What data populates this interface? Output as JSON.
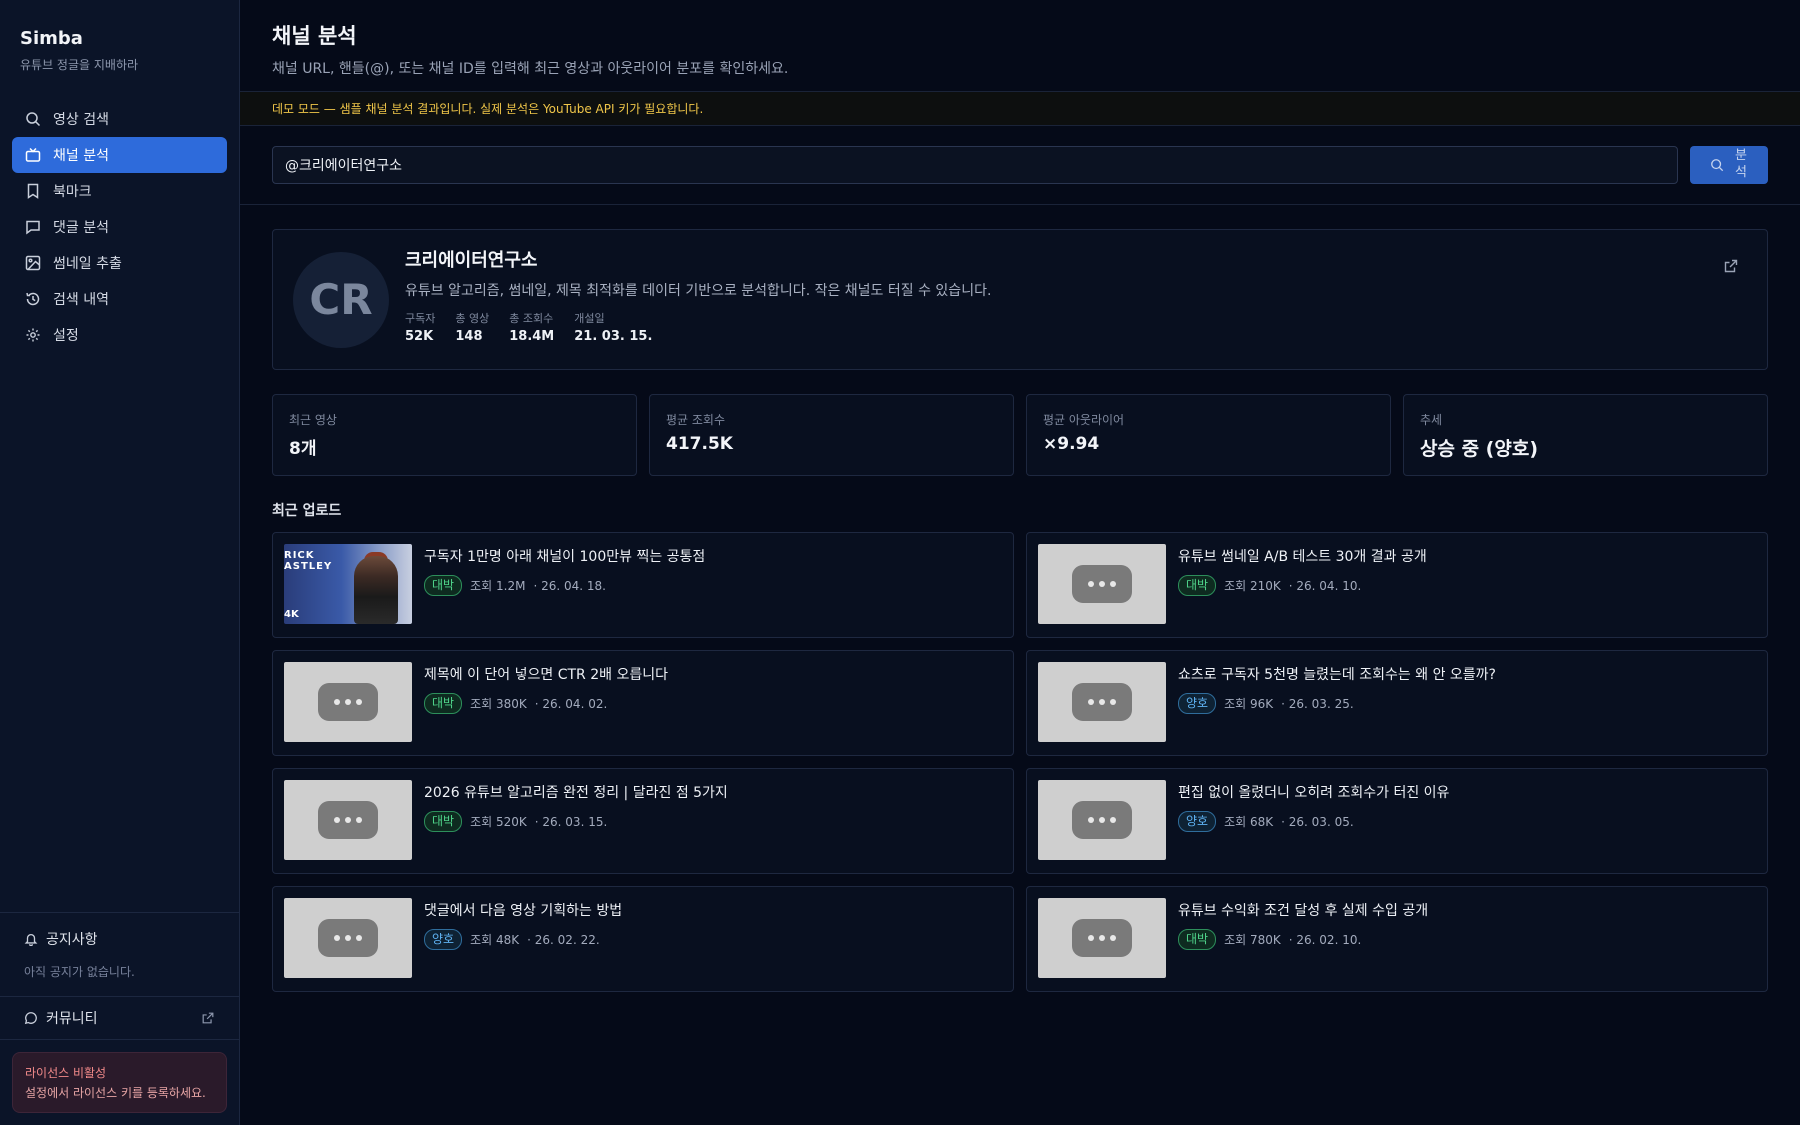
{
  "brand": {
    "name": "Simba",
    "tagline": "유튜브 정글을 지배하라"
  },
  "nav": [
    {
      "label": "영상 검색",
      "icon": "search-icon"
    },
    {
      "label": "채널 분석",
      "icon": "tv-icon",
      "active": true
    },
    {
      "label": "북마크",
      "icon": "bookmark-icon"
    },
    {
      "label": "댓글 분석",
      "icon": "comment-icon"
    },
    {
      "label": "썸네일 추출",
      "icon": "image-icon"
    },
    {
      "label": "검색 내역",
      "icon": "history-icon"
    },
    {
      "label": "설정",
      "icon": "gear-icon"
    }
  ],
  "notice": {
    "title": "공지사항",
    "empty": "아직 공지가 없습니다."
  },
  "community": {
    "label": "커뮤니티"
  },
  "license": {
    "title": "라이선스 비활성",
    "body": "설정에서 라이선스 키를 등록하세요."
  },
  "header": {
    "title": "채널 분석",
    "subtitle": "채널 URL, 핸들(@), 또는 채널 ID를 입력해 최근 영상과 아웃라이어 분포를 확인하세요."
  },
  "demo_banner": "데모 모드 — 샘플 채널 분석 결과입니다. 실제 분석은 YouTube API 키가 필요합니다.",
  "search": {
    "value": "@크리에이터연구소",
    "button_label": "분석"
  },
  "channel": {
    "avatar": "CR",
    "name": "크리에이터연구소",
    "description": "유튜브 알고리즘, 썸네일, 제목 최적화를 데이터 기반으로 분석합니다. 작은 채널도 터질 수 있습니다.",
    "stats": [
      {
        "label": "구독자",
        "value": "52K"
      },
      {
        "label": "총 영상",
        "value": "148"
      },
      {
        "label": "총 조회수",
        "value": "18.4M"
      },
      {
        "label": "개설일",
        "value": "21. 03. 15."
      }
    ]
  },
  "metrics": [
    {
      "label": "최근 영상",
      "value": "8개"
    },
    {
      "label": "평균 조회수",
      "value": "417.5K"
    },
    {
      "label": "평균 아웃라이어",
      "value": "×9.94"
    },
    {
      "label": "추세",
      "value": "상승 중 (양호)"
    }
  ],
  "recent": {
    "title": "최근 업로드",
    "videos": [
      {
        "title": "구독자 1만명 아래 채널이 100만뷰 찍는 공통점",
        "badge": "대박",
        "views": "조회 1.2M",
        "date": "· 26. 04. 18.",
        "thumb_text": "RICK\nASTLEY",
        "thumb_4k": "4K"
      },
      {
        "title": "유튜브 썸네일 A/B 테스트 30개 결과 공개",
        "badge": "대박",
        "views": "조회 210K",
        "date": "· 26. 04. 10."
      },
      {
        "title": "제목에 이 단어 넣으면 CTR 2배 오릅니다",
        "badge": "대박",
        "views": "조회 380K",
        "date": "· 26. 04. 02."
      },
      {
        "title": "쇼츠로 구독자 5천명 늘렸는데 조회수는 왜 안 오를까?",
        "badge": "양호",
        "views": "조회 96K",
        "date": "· 26. 03. 25."
      },
      {
        "title": "2026 유튜브 알고리즘 완전 정리 | 달라진 점 5가지",
        "badge": "대박",
        "views": "조회 520K",
        "date": "· 26. 03. 15."
      },
      {
        "title": "편집 없이 올렸더니 오히려 조회수가 터진 이유",
        "badge": "양호",
        "views": "조회 68K",
        "date": "· 26. 03. 05."
      },
      {
        "title": "댓글에서 다음 영상 기획하는 방법",
        "badge": "양호",
        "views": "조회 48K",
        "date": "· 26. 02. 22."
      },
      {
        "title": "유튜브 수익화 조건 달성 후 실제 수입 공개",
        "badge": "대박",
        "views": "조회 780K",
        "date": "· 26. 02. 10."
      }
    ]
  },
  "colors": {
    "accent": "#2e6bdb",
    "hit": "#4fd48a",
    "good": "#5fb2f2",
    "warning": "#f0c649"
  }
}
